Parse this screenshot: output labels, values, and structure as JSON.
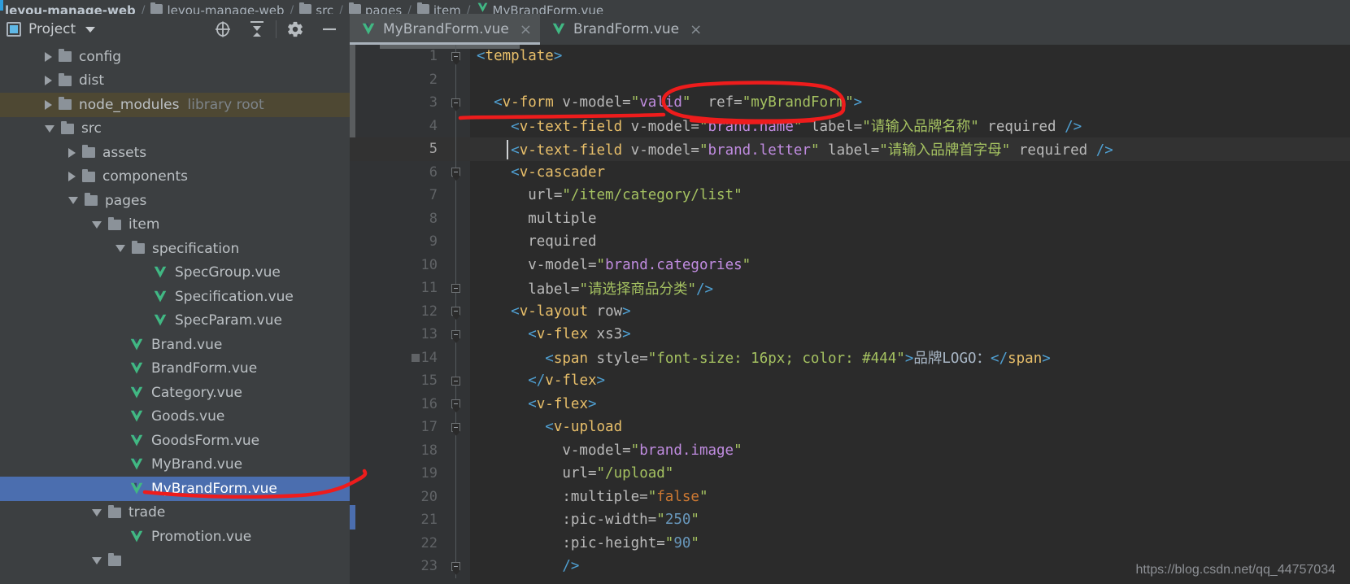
{
  "breadcrumb": {
    "items": [
      {
        "label": "leyou-manage-web",
        "icon": "none",
        "bold": true
      },
      {
        "label": "leyou-manage-web",
        "icon": "folder-icon",
        "bold": false
      },
      {
        "label": "src",
        "icon": "folder-icon",
        "bold": false
      },
      {
        "label": "pages",
        "icon": "folder-icon",
        "bold": false
      },
      {
        "label": "item",
        "icon": "folder-icon",
        "bold": false
      },
      {
        "label": "MyBrandForm.vue",
        "icon": "vue-icon",
        "bold": false
      }
    ],
    "separator": "/"
  },
  "sidebar": {
    "title": "Project",
    "dropdown_icon": "chevron-down-icon",
    "tools": [
      {
        "name": "locate-icon",
        "glyph": "crosshair"
      },
      {
        "name": "collapse-all-icon",
        "glyph": "collapse"
      },
      {
        "name": "settings-icon",
        "glyph": "gear"
      },
      {
        "name": "hide-panel-icon",
        "glyph": "minus"
      }
    ],
    "tree": [
      {
        "label": "config",
        "sub": "",
        "indent": 1,
        "type": "folder",
        "state": "collapsed",
        "row": "normal"
      },
      {
        "label": "dist",
        "sub": "",
        "indent": 1,
        "type": "folder",
        "state": "collapsed",
        "row": "normal"
      },
      {
        "label": "node_modules",
        "sub": "library root",
        "indent": 1,
        "type": "folder",
        "state": "collapsed",
        "row": "highlight"
      },
      {
        "label": "src",
        "sub": "",
        "indent": 1,
        "type": "folder",
        "state": "expanded",
        "row": "normal"
      },
      {
        "label": "assets",
        "sub": "",
        "indent": 2,
        "type": "folder",
        "state": "collapsed",
        "row": "normal"
      },
      {
        "label": "components",
        "sub": "",
        "indent": 2,
        "type": "folder",
        "state": "collapsed",
        "row": "normal"
      },
      {
        "label": "pages",
        "sub": "",
        "indent": 2,
        "type": "folder",
        "state": "expanded",
        "row": "normal"
      },
      {
        "label": "item",
        "sub": "",
        "indent": 3,
        "type": "folder",
        "state": "expanded",
        "row": "normal"
      },
      {
        "label": "specification",
        "sub": "",
        "indent": 4,
        "type": "folder",
        "state": "expanded",
        "row": "normal"
      },
      {
        "label": "SpecGroup.vue",
        "sub": "",
        "indent": 5,
        "type": "vue",
        "state": "leaf",
        "row": "normal"
      },
      {
        "label": "Specification.vue",
        "sub": "",
        "indent": 5,
        "type": "vue",
        "state": "leaf",
        "row": "normal"
      },
      {
        "label": "SpecParam.vue",
        "sub": "",
        "indent": 5,
        "type": "vue",
        "state": "leaf",
        "row": "normal"
      },
      {
        "label": "Brand.vue",
        "sub": "",
        "indent": 4,
        "type": "vue",
        "state": "leaf",
        "row": "normal"
      },
      {
        "label": "BrandForm.vue",
        "sub": "",
        "indent": 4,
        "type": "vue",
        "state": "leaf",
        "row": "normal"
      },
      {
        "label": "Category.vue",
        "sub": "",
        "indent": 4,
        "type": "vue",
        "state": "leaf",
        "row": "normal"
      },
      {
        "label": "Goods.vue",
        "sub": "",
        "indent": 4,
        "type": "vue",
        "state": "leaf",
        "row": "normal"
      },
      {
        "label": "GoodsForm.vue",
        "sub": "",
        "indent": 4,
        "type": "vue",
        "state": "leaf",
        "row": "normal"
      },
      {
        "label": "MyBrand.vue",
        "sub": "",
        "indent": 4,
        "type": "vue",
        "state": "leaf",
        "row": "normal"
      },
      {
        "label": "MyBrandForm.vue",
        "sub": "",
        "indent": 4,
        "type": "vue",
        "state": "leaf",
        "row": "selected"
      },
      {
        "label": "trade",
        "sub": "",
        "indent": 3,
        "type": "folder",
        "state": "expanded",
        "row": "normal"
      },
      {
        "label": "Promotion.vue",
        "sub": "",
        "indent": 4,
        "type": "vue",
        "state": "leaf",
        "row": "normal"
      },
      {
        "label": "",
        "sub": "",
        "indent": 3,
        "type": "folder",
        "state": "expanded",
        "row": "normal"
      }
    ]
  },
  "editor": {
    "tabs": [
      {
        "label": "MyBrandForm.vue",
        "icon": "vue-icon",
        "close": "×",
        "active": true
      },
      {
        "label": "BrandForm.vue",
        "icon": "vue-icon",
        "close": "×",
        "active": false
      }
    ],
    "current_line": 5,
    "lines": [
      {
        "n": "1",
        "fold": "start",
        "indent": 0,
        "tokens": [
          {
            "t": "brack",
            "v": "<"
          },
          {
            "t": "tag",
            "v": "template"
          },
          {
            "t": "brack",
            "v": ">"
          }
        ]
      },
      {
        "n": "2",
        "fold": "none",
        "indent": 0,
        "tokens": []
      },
      {
        "n": "3",
        "fold": "start",
        "indent": 1,
        "tokens": [
          {
            "t": "brack",
            "v": "<"
          },
          {
            "t": "tag",
            "v": "v-form "
          },
          {
            "t": "attr",
            "v": "v-model="
          },
          {
            "t": "str",
            "v": "\""
          },
          {
            "t": "var",
            "v": "valid"
          },
          {
            "t": "str",
            "v": "\""
          },
          {
            "t": "attr",
            "v": "  ref="
          },
          {
            "t": "str",
            "v": "\"myBrandForm\""
          },
          {
            "t": "brack",
            "v": ">"
          }
        ]
      },
      {
        "n": "4",
        "fold": "none",
        "indent": 2,
        "tokens": [
          {
            "t": "brack",
            "v": "<"
          },
          {
            "t": "tag",
            "v": "v-text-field "
          },
          {
            "t": "attr",
            "v": "v-model="
          },
          {
            "t": "str",
            "v": "\""
          },
          {
            "t": "var",
            "v": "brand.name"
          },
          {
            "t": "str",
            "v": "\""
          },
          {
            "t": "attr",
            "v": " label="
          },
          {
            "t": "str",
            "v": "\"请输入品牌名称\""
          },
          {
            "t": "attr",
            "v": " required "
          },
          {
            "t": "brack",
            "v": "/>"
          }
        ]
      },
      {
        "n": "5",
        "fold": "none",
        "indent": 2,
        "tokens": [
          {
            "t": "brack",
            "v": "<"
          },
          {
            "t": "tag",
            "v": "v-text-field "
          },
          {
            "t": "attr",
            "v": "v-model="
          },
          {
            "t": "str",
            "v": "\""
          },
          {
            "t": "var",
            "v": "brand.letter"
          },
          {
            "t": "str",
            "v": "\""
          },
          {
            "t": "attr",
            "v": " label="
          },
          {
            "t": "str",
            "v": "\"请输入品牌首字母\""
          },
          {
            "t": "attr",
            "v": " required "
          },
          {
            "t": "brack",
            "v": "/>"
          }
        ]
      },
      {
        "n": "6",
        "fold": "start",
        "indent": 2,
        "tokens": [
          {
            "t": "brack",
            "v": "<"
          },
          {
            "t": "tag",
            "v": "v-cascader"
          }
        ]
      },
      {
        "n": "7",
        "fold": "none",
        "indent": 3,
        "tokens": [
          {
            "t": "attr",
            "v": "url="
          },
          {
            "t": "str",
            "v": "\"/item/category/list\""
          }
        ]
      },
      {
        "n": "8",
        "fold": "none",
        "indent": 3,
        "tokens": [
          {
            "t": "attr",
            "v": "multiple"
          }
        ]
      },
      {
        "n": "9",
        "fold": "none",
        "indent": 3,
        "tokens": [
          {
            "t": "attr",
            "v": "required"
          }
        ]
      },
      {
        "n": "10",
        "fold": "none",
        "indent": 3,
        "tokens": [
          {
            "t": "attr",
            "v": "v-model="
          },
          {
            "t": "str",
            "v": "\""
          },
          {
            "t": "var",
            "v": "brand.categories"
          },
          {
            "t": "str",
            "v": "\""
          }
        ]
      },
      {
        "n": "11",
        "fold": "end",
        "indent": 3,
        "tokens": [
          {
            "t": "attr",
            "v": "label="
          },
          {
            "t": "str",
            "v": "\"请选择商品分类\""
          },
          {
            "t": "brack",
            "v": "/>"
          }
        ]
      },
      {
        "n": "12",
        "fold": "start",
        "indent": 2,
        "tokens": [
          {
            "t": "brack",
            "v": "<"
          },
          {
            "t": "tag",
            "v": "v-layout "
          },
          {
            "t": "attr",
            "v": "row"
          },
          {
            "t": "brack",
            "v": ">"
          }
        ]
      },
      {
        "n": "13",
        "fold": "start",
        "indent": 3,
        "tokens": [
          {
            "t": "brack",
            "v": "<"
          },
          {
            "t": "tag",
            "v": "v-flex "
          },
          {
            "t": "attr",
            "v": "xs3"
          },
          {
            "t": "brack",
            "v": ">"
          }
        ]
      },
      {
        "n": "14",
        "fold": "mark",
        "indent": 4,
        "tokens": [
          {
            "t": "brack",
            "v": "<"
          },
          {
            "t": "tag",
            "v": "span "
          },
          {
            "t": "attr",
            "v": "style="
          },
          {
            "t": "str",
            "v": "\"font-size: 16px; color: #444\""
          },
          {
            "t": "brack",
            "v": ">"
          },
          {
            "t": "plain",
            "v": "品牌LOGO："
          },
          {
            "t": "brack",
            "v": "</"
          },
          {
            "t": "tag",
            "v": "span"
          },
          {
            "t": "brack",
            "v": ">"
          }
        ]
      },
      {
        "n": "15",
        "fold": "end",
        "indent": 3,
        "tokens": [
          {
            "t": "brack",
            "v": "</"
          },
          {
            "t": "tag",
            "v": "v-flex"
          },
          {
            "t": "brack",
            "v": ">"
          }
        ]
      },
      {
        "n": "16",
        "fold": "start",
        "indent": 3,
        "tokens": [
          {
            "t": "brack",
            "v": "<"
          },
          {
            "t": "tag",
            "v": "v-flex"
          },
          {
            "t": "brack",
            "v": ">"
          }
        ]
      },
      {
        "n": "17",
        "fold": "start",
        "indent": 4,
        "tokens": [
          {
            "t": "brack",
            "v": "<"
          },
          {
            "t": "tag",
            "v": "v-upload"
          }
        ]
      },
      {
        "n": "18",
        "fold": "none",
        "indent": 5,
        "tokens": [
          {
            "t": "attr",
            "v": "v-model="
          },
          {
            "t": "str",
            "v": "\""
          },
          {
            "t": "var",
            "v": "brand.image"
          },
          {
            "t": "str",
            "v": "\""
          }
        ]
      },
      {
        "n": "19",
        "fold": "none",
        "indent": 5,
        "tokens": [
          {
            "t": "attr",
            "v": "url="
          },
          {
            "t": "str",
            "v": "\"/upload\""
          }
        ]
      },
      {
        "n": "20",
        "fold": "none",
        "indent": 5,
        "tokens": [
          {
            "t": "attr",
            "v": ":multiple="
          },
          {
            "t": "str",
            "v": "\""
          },
          {
            "t": "bool",
            "v": "false"
          },
          {
            "t": "str",
            "v": "\""
          }
        ]
      },
      {
        "n": "21",
        "fold": "none",
        "indent": 5,
        "tokens": [
          {
            "t": "attr",
            "v": ":pic-width="
          },
          {
            "t": "str",
            "v": "\""
          },
          {
            "t": "num",
            "v": "250"
          },
          {
            "t": "str",
            "v": "\""
          }
        ]
      },
      {
        "n": "22",
        "fold": "none",
        "indent": 5,
        "tokens": [
          {
            "t": "attr",
            "v": ":pic-height="
          },
          {
            "t": "str",
            "v": "\""
          },
          {
            "t": "num",
            "v": "90"
          },
          {
            "t": "str",
            "v": "\""
          }
        ]
      },
      {
        "n": "23",
        "fold": "start",
        "indent": 5,
        "tokens": [
          {
            "t": "brack",
            "v": "/>"
          }
        ]
      }
    ]
  },
  "annotation": {
    "color": "#ee1c1c",
    "shapes": "ellipse-around-ref-attribute, underline-under-form-line, underline-under-selected-file"
  },
  "watermark": "https://blog.csdn.net/qq_44757034"
}
